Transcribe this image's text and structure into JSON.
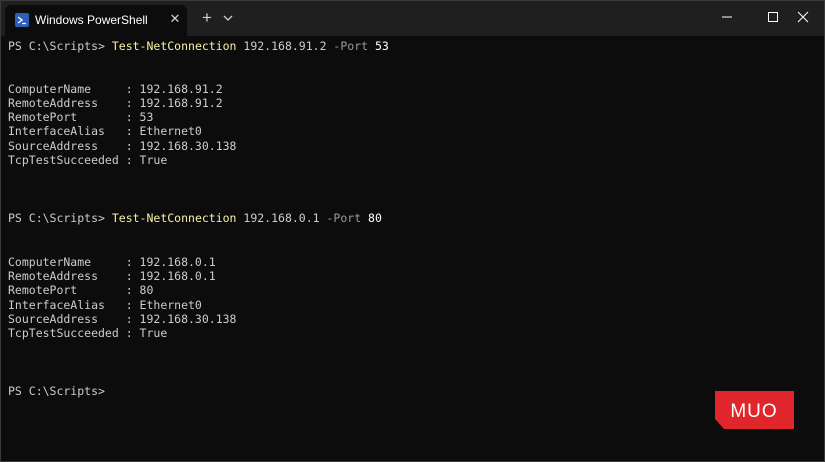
{
  "window": {
    "tab_title": "Windows PowerShell",
    "tab_close": "✕",
    "new_tab": "+"
  },
  "terminal": {
    "blocks": [
      {
        "prompt": "PS C:\\Scripts> ",
        "command": "Test-NetConnection",
        "address": " 192.168.91.2 ",
        "param": "-Port",
        "port": " 53",
        "results": [
          "ComputerName     : 192.168.91.2",
          "RemoteAddress    : 192.168.91.2",
          "RemotePort       : 53",
          "InterfaceAlias   : Ethernet0",
          "SourceAddress    : 192.168.30.138",
          "TcpTestSucceeded : True"
        ]
      },
      {
        "prompt": "PS C:\\Scripts> ",
        "command": "Test-NetConnection",
        "address": " 192.168.0.1 ",
        "param": "-Port",
        "port": " 80",
        "results": [
          "ComputerName     : 192.168.0.1",
          "RemoteAddress    : 192.168.0.1",
          "RemotePort       : 80",
          "InterfaceAlias   : Ethernet0",
          "SourceAddress    : 192.168.30.138",
          "TcpTestSucceeded : True"
        ]
      }
    ],
    "final_prompt": "PS C:\\Scripts>"
  },
  "watermark": {
    "text": "MUO",
    "color": "#e0262a"
  }
}
